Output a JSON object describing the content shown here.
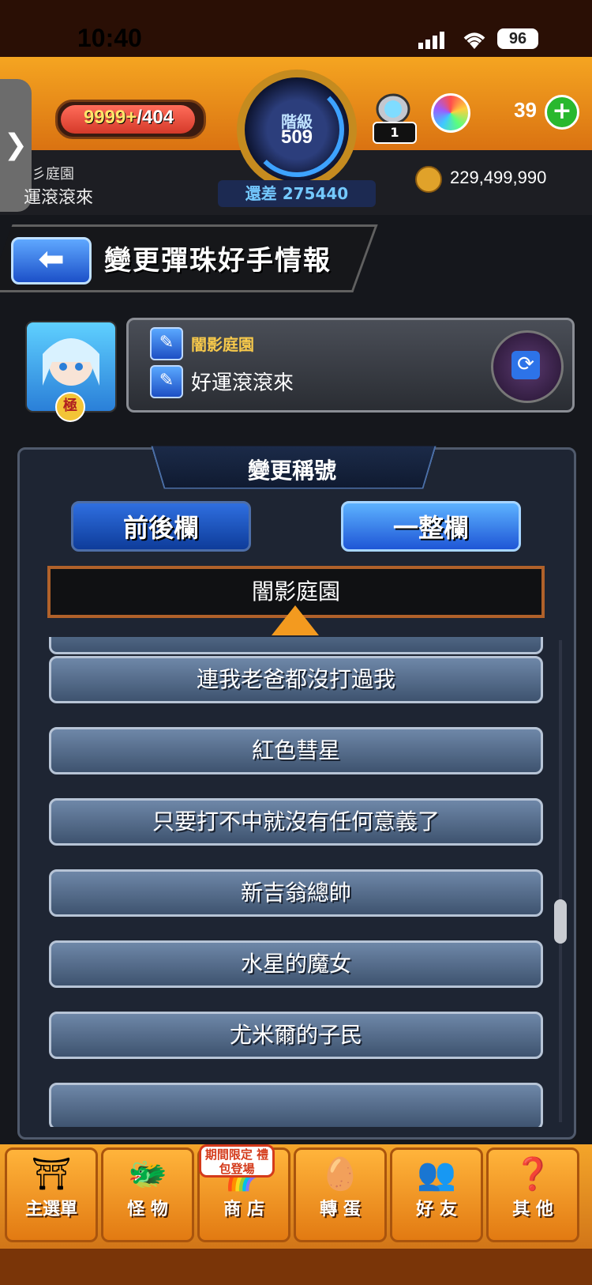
{
  "status_bar": {
    "time": "10:40",
    "battery": "96"
  },
  "hud": {
    "stamina_current": "9999+",
    "stamina_max": "/404",
    "rank_label": "階級",
    "rank_value": "509",
    "exp_remaining": "還差 275440",
    "player_title": "彡庭園",
    "player_name": "運滾滾來",
    "egg_count": "1",
    "orb_count": "39",
    "coin_count": "229,499,990",
    "sidebar_arrow": "❯"
  },
  "header": {
    "back_icon": "⬅",
    "title": "變更彈珠好手情報"
  },
  "profile": {
    "avatar_badge": "極",
    "current_title": "闇影庭園",
    "current_name": "好運滾滾來",
    "edit_icon": "✎",
    "swap_icon": "⟳"
  },
  "panel": {
    "title": "變更稱號",
    "tabs": [
      "前後欄",
      "一整欄"
    ],
    "selected_title": "闇影庭園",
    "items": [
      "連我老爸都沒打過我",
      "紅色彗星",
      "只要打不中就沒有任何意義了",
      "新吉翁總帥",
      "水星的魔女",
      "尤米爾的子民"
    ]
  },
  "nav": {
    "shop_badge": "期間限定 禮包登場",
    "items": [
      {
        "label": "主選單",
        "icon": "⛩"
      },
      {
        "label": "怪 物",
        "icon": "🐲"
      },
      {
        "label": "商 店",
        "icon": "🌈"
      },
      {
        "label": "轉 蛋",
        "icon": "🥚"
      },
      {
        "label": "好 友",
        "icon": "👥"
      },
      {
        "label": "其 他",
        "icon": "❓"
      }
    ]
  },
  "colors": {
    "accent_orange": "#f39a1f",
    "button_blue": "#1e56d6",
    "selected_border": "#b0612a"
  }
}
